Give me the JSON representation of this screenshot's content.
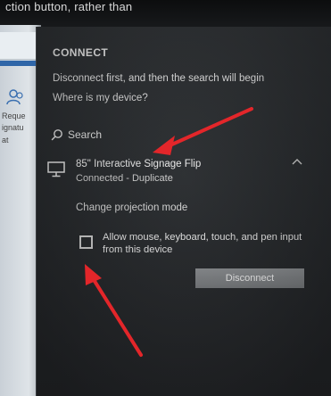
{
  "top_bar": {
    "partial_text": "ction button, rather than"
  },
  "background_window": {
    "labels": [
      "Reque",
      "ignatu",
      "at"
    ]
  },
  "panel": {
    "heading": "CONNECT",
    "info_text": "Disconnect first, and then the search will begin",
    "help_link": "Where is my device?",
    "search_label": "Search",
    "device": {
      "name": "85\" Interactive Signage Flip",
      "status": "Connected - Duplicate"
    },
    "change_mode_label": "Change projection mode",
    "checkbox_label": "Allow mouse, keyboard, touch, and pen input from this device",
    "checkbox_checked": false,
    "disconnect_label": "Disconnect"
  },
  "colors": {
    "panel_bg": "#2b2e31",
    "text": "#e8e8e8",
    "button_bg": "#808386",
    "annotation_arrow": "#e3262a"
  },
  "icons": {
    "search": "search-icon",
    "device": "monitor-icon",
    "expand": "chevron-up-icon"
  }
}
